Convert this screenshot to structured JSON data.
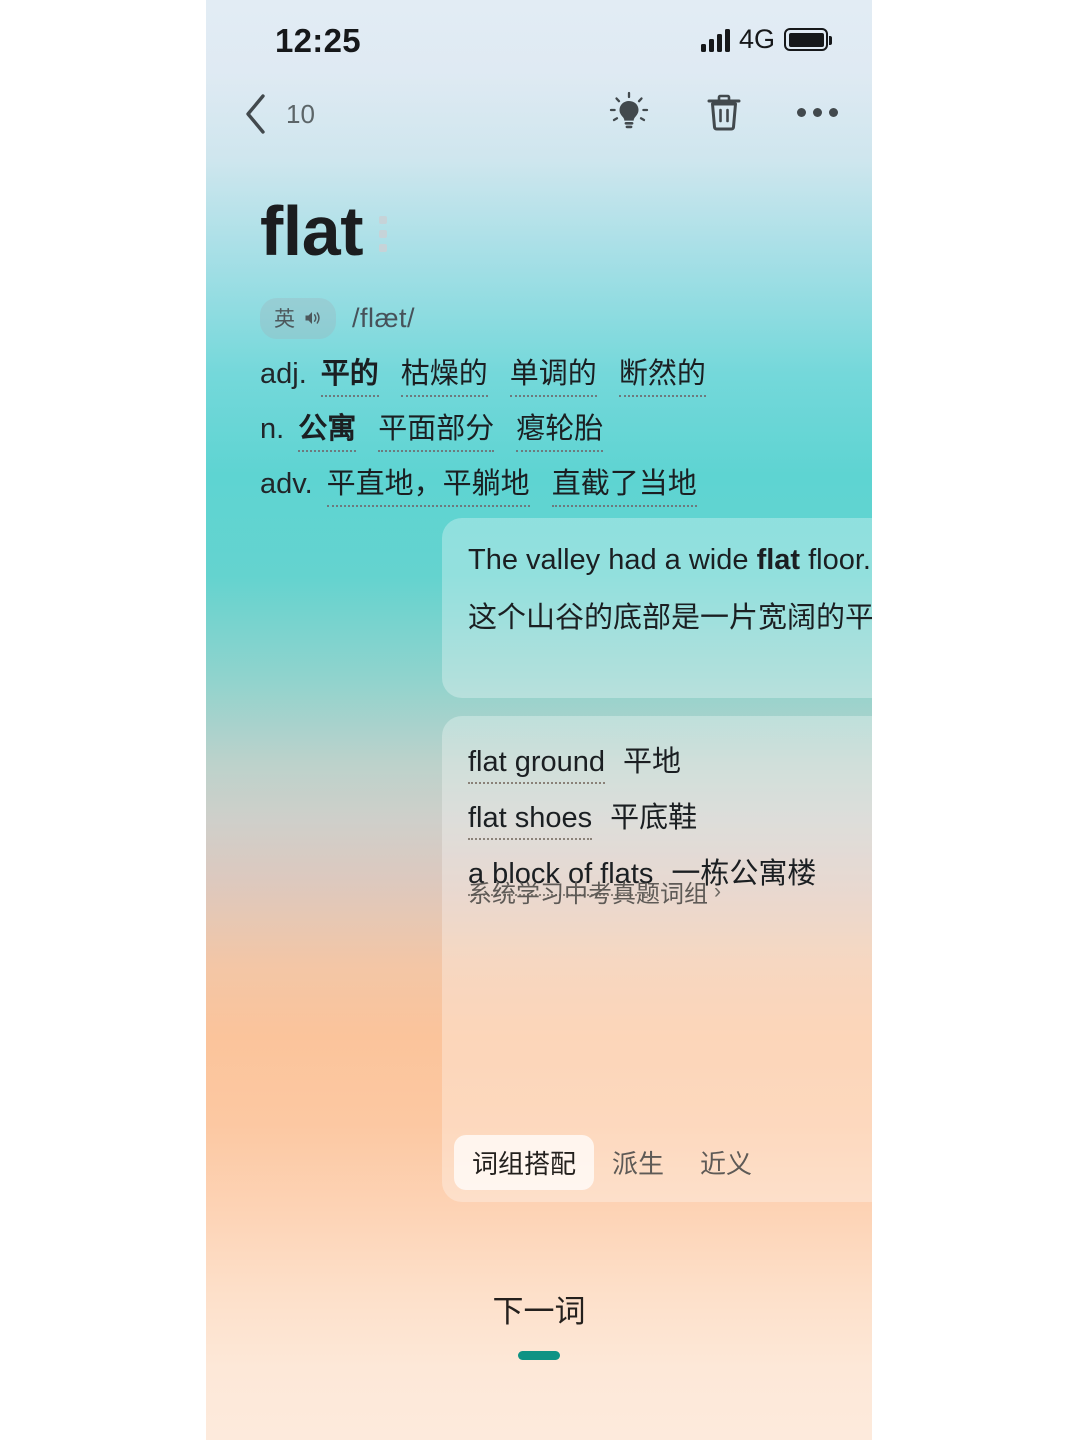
{
  "status_bar": {
    "time": "12:25",
    "network": "4G",
    "signal_icon": "signal-bars-icon",
    "battery_icon": "battery-icon"
  },
  "nav_bar": {
    "back_icon": "chevron-left-icon",
    "count": "10",
    "hint_icon": "lightbulb-icon",
    "delete_icon": "trash-icon",
    "more_icon": "more-horizontal-icon"
  },
  "word": {
    "headword": "flat",
    "menu_icon": "more-vertical-icon",
    "pron_lang": "英",
    "speaker_icon": "speaker-icon",
    "ipa": "/flæt/"
  },
  "definitions": [
    {
      "pos": "adj.",
      "senses": [
        "平的",
        "枯燥的",
        "单调的",
        "断然的"
      ],
      "first_bold": true
    },
    {
      "pos": "n.",
      "senses": [
        "公寓",
        "平面部分",
        "瘪轮胎"
      ],
      "first_bold": true
    },
    {
      "pos": "adv.",
      "senses": [
        "平直地，平躺地",
        "直截了当地"
      ],
      "first_bold": false
    }
  ],
  "example": {
    "english_before": "The valley had a wide ",
    "english_bold": "flat",
    "english_after": " floor.",
    "chinese": "这个山谷的底部是一片宽阔的平地。",
    "card_icon": "card-play-icon"
  },
  "phrases": {
    "items": [
      {
        "en": "flat ground",
        "zh": "平地"
      },
      {
        "en": "flat shoes",
        "zh": "平底鞋"
      },
      {
        "en": "a block of flats",
        "zh": "一栋公寓楼"
      }
    ],
    "link_label": "系统学习中考真题词组",
    "link_chevron": "›"
  },
  "tabs": [
    {
      "label": "词组搭配",
      "active": true
    },
    {
      "label": "派生",
      "active": false
    },
    {
      "label": "近义",
      "active": false
    }
  ],
  "tab_actions": {
    "note_icon": "pen-add-icon",
    "search_icon": "search-icon"
  },
  "footer": {
    "next_word": "下一词",
    "indicator_color": "#0f9384"
  }
}
